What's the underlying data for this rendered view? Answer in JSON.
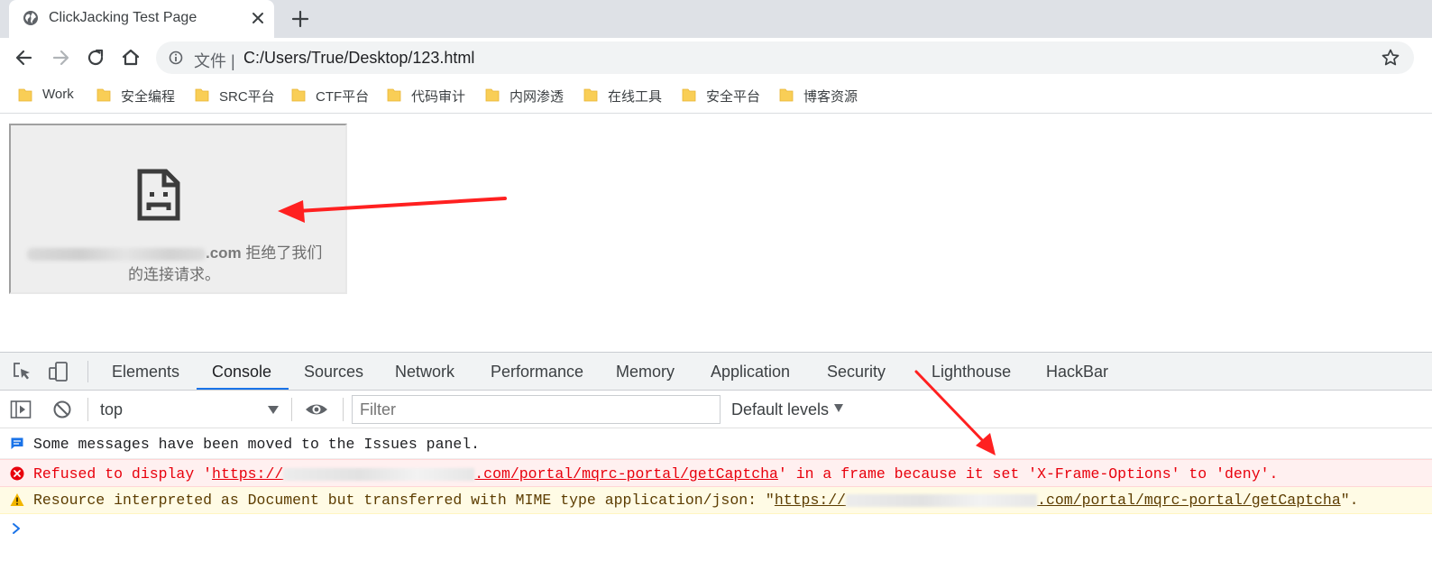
{
  "browser": {
    "tab": {
      "title": "ClickJacking Test Page"
    },
    "address": {
      "scheme_label": "文件",
      "url": "C:/Users/True/Desktop/123.html"
    }
  },
  "bookmarks": [
    {
      "label": "Work"
    },
    {
      "label": "安全编程"
    },
    {
      "label": "SRC平台"
    },
    {
      "label": "CTF平台"
    },
    {
      "label": "代码审计"
    },
    {
      "label": "内网渗透"
    },
    {
      "label": "在线工具"
    },
    {
      "label": "安全平台"
    },
    {
      "label": "博客资源"
    }
  ],
  "iframe_error": {
    "domain_suffix": ".com",
    "message_line1": " 拒绝了我们",
    "message_line2": "的连接请求。"
  },
  "devtools": {
    "tabs": [
      {
        "label": "Elements"
      },
      {
        "label": "Console"
      },
      {
        "label": "Sources"
      },
      {
        "label": "Network"
      },
      {
        "label": "Performance"
      },
      {
        "label": "Memory"
      },
      {
        "label": "Application"
      },
      {
        "label": "Security"
      },
      {
        "label": "Lighthouse"
      },
      {
        "label": "HackBar"
      }
    ],
    "active_tab": "Console",
    "context": "top",
    "filter_placeholder": "Filter",
    "levels": "Default levels"
  },
  "console": {
    "info": "Some messages have been moved to the Issues panel.",
    "error": {
      "prefix": "Refused to display '",
      "link_start": "https://",
      "link_end": ".com/portal/mqrc-portal/getCaptcha",
      "suffix": "' in a frame because it set 'X-Frame-Options' to 'deny'."
    },
    "warning": {
      "prefix": "Resource interpreted as Document but transferred with MIME type application/json: \"",
      "link_start": "https://",
      "link_end": ".com/portal/mqrc-portal/getCaptcha",
      "suffix": "\"."
    }
  },
  "colors": {
    "tab_strip": "#dee1e6",
    "active_tab_underline": "#1a73e8",
    "error_text": "#e8000c",
    "annotation_arrow": "#ff2020"
  }
}
